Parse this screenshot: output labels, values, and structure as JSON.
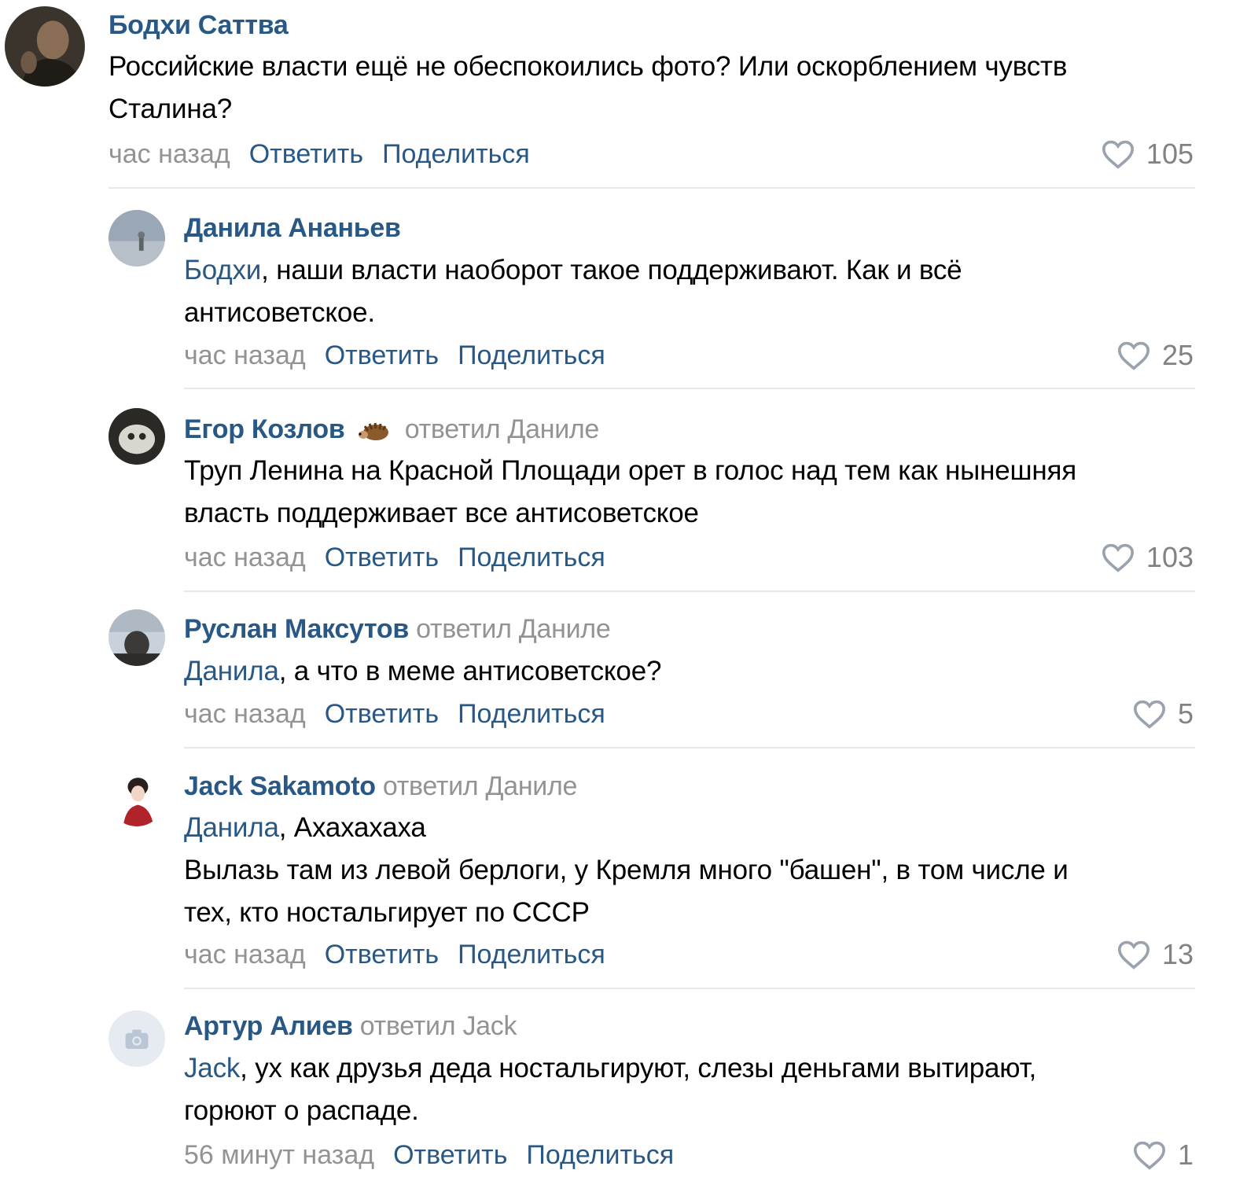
{
  "comments": [
    {
      "author": "Бодхи Саттва",
      "replied_label": "",
      "replied_to": "",
      "mention": "",
      "text_lines": [
        "Российские власти ещё не обеспокоились фото? Или оскорблением чувств",
        "Сталина?"
      ],
      "time": "час назад",
      "reply_label": "Ответить",
      "share_label": "Поделиться",
      "likes": "105",
      "avatar_icon": "user-photo-avatar"
    },
    {
      "author": "Данила Ананьев",
      "replied_label": "",
      "replied_to": "",
      "mention": "Бодхи",
      "text_lines": [
        ", наши власти наоборот такое поддерживают. Как и всё",
        "антисоветское."
      ],
      "time": "час назад",
      "reply_label": "Ответить",
      "share_label": "Поделиться",
      "likes": "25",
      "avatar_icon": "user-photo-avatar"
    },
    {
      "author": "Егор Козлов",
      "replied_label": "ответил",
      "replied_to": "Даниле",
      "mention": "",
      "text_lines": [
        "Труп Ленина на Красной Площади орет в голос над тем как нынешняя",
        "власть поддерживает все антисоветское"
      ],
      "time": "час назад",
      "reply_label": "Ответить",
      "share_label": "Поделиться",
      "likes": "103",
      "avatar_icon": "user-photo-avatar",
      "badge_icon": "hedgehog-emoji-icon"
    },
    {
      "author": "Руслан Максутов",
      "replied_label": "ответил",
      "replied_to": "Даниле",
      "mention": "Данила",
      "text_lines": [
        ", а что в меме антисоветское?"
      ],
      "time": "час назад",
      "reply_label": "Ответить",
      "share_label": "Поделиться",
      "likes": "5",
      "avatar_icon": "user-photo-avatar"
    },
    {
      "author": "Jack Sakamoto",
      "replied_label": "ответил",
      "replied_to": "Даниле",
      "mention": "Данила",
      "text_lines": [
        ", Ахахахаха",
        "Вылазь там из левой берлоги, у Кремля много \"башен\", в том числе и",
        "тех, кто ностальгирует по СССР"
      ],
      "time": "час назад",
      "reply_label": "Ответить",
      "share_label": "Поделиться",
      "likes": "13",
      "avatar_icon": "user-photo-avatar"
    },
    {
      "author": "Артур Алиев",
      "replied_label": "ответил",
      "replied_to": "Jack",
      "mention": "Jack",
      "text_lines": [
        ", ух как друзья деда ностальгируют, слезы деньгами вытирают,",
        "горюют о распаде."
      ],
      "time": "56 минут назад",
      "reply_label": "Ответить",
      "share_label": "Поделиться",
      "likes": "1",
      "avatar_icon": "camera-placeholder-icon"
    }
  ],
  "colors": {
    "link": "#2a5885",
    "muted": "#939393",
    "text": "#000000",
    "divider": "#e7e8ec"
  }
}
